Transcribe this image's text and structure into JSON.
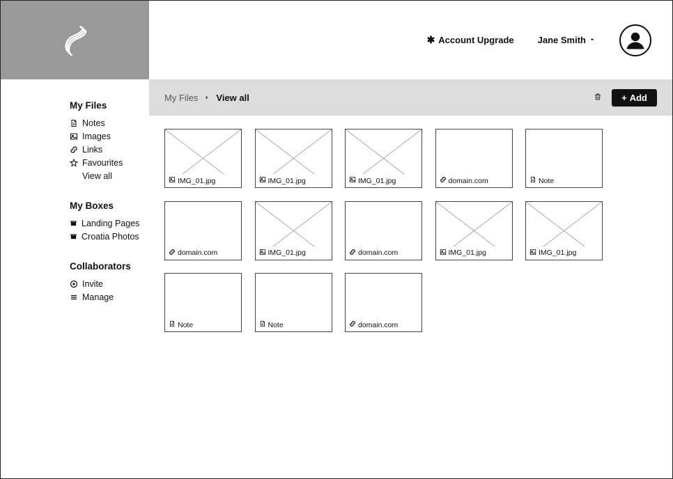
{
  "header": {
    "upgrade_label": "Account Upgrade",
    "user_name": "Jane Smith"
  },
  "sidebar": {
    "myfiles": {
      "heading": "My Files",
      "items": [
        {
          "icon": "note",
          "label": "Notes"
        },
        {
          "icon": "image",
          "label": "Images"
        },
        {
          "icon": "link",
          "label": "Links"
        },
        {
          "icon": "star",
          "label": "Favourites"
        },
        {
          "icon": "",
          "label": "View all"
        }
      ]
    },
    "myboxes": {
      "heading": "My Boxes",
      "items": [
        {
          "icon": "box",
          "label": "Landing Pages"
        },
        {
          "icon": "box",
          "label": "Croatia Photos"
        }
      ]
    },
    "collaborators": {
      "heading": "Collaborators",
      "items": [
        {
          "icon": "plus-circle",
          "label": "Invite"
        },
        {
          "icon": "menu",
          "label": "Manage"
        }
      ]
    }
  },
  "breadcrumb": {
    "root": "My Files",
    "current": "View all"
  },
  "actions": {
    "add_label": "Add"
  },
  "tiles": [
    {
      "type": "image",
      "label": "IMG_01.jpg"
    },
    {
      "type": "image",
      "label": "IMG_01.jpg"
    },
    {
      "type": "image",
      "label": "IMG_01.jpg"
    },
    {
      "type": "link",
      "label": "domain.com"
    },
    {
      "type": "note",
      "label": "Note"
    },
    {
      "type": "link",
      "label": "domain.com"
    },
    {
      "type": "image",
      "label": "IMG_01.jpg"
    },
    {
      "type": "link",
      "label": "domain.com"
    },
    {
      "type": "image",
      "label": "IMG_01.jpg"
    },
    {
      "type": "image",
      "label": "IMG_01.jpg"
    },
    {
      "type": "note",
      "label": "Note"
    },
    {
      "type": "note",
      "label": "Note"
    },
    {
      "type": "link",
      "label": "domain.com"
    }
  ]
}
